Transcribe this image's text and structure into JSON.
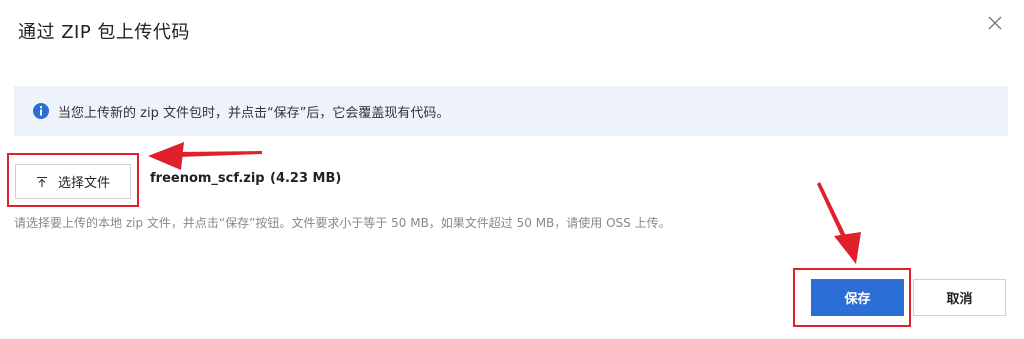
{
  "dialog": {
    "title": "通过 ZIP 包上传代码",
    "close_icon": "close-icon"
  },
  "info": {
    "icon": "info-icon",
    "color": "#2b6fd6",
    "text": "当您上传新的 zip 文件包时，并点击“保存”后，它会覆盖现有代码。"
  },
  "upload": {
    "button_label": "选择文件",
    "button_icon": "upload-icon",
    "file_name": "freenom_scf.zip",
    "file_size": "(4.23 MB)",
    "hint": "请选择要上传的本地 zip 文件，并点击“保存”按钮。文件要求小于等于 50 MB，如果文件超过 50 MB，请使用 OSS 上传。"
  },
  "actions": {
    "save_label": "保存",
    "cancel_label": "取消",
    "save_color": "#2b6fd6"
  },
  "annotations": {
    "highlight_color": "#e0202a"
  }
}
